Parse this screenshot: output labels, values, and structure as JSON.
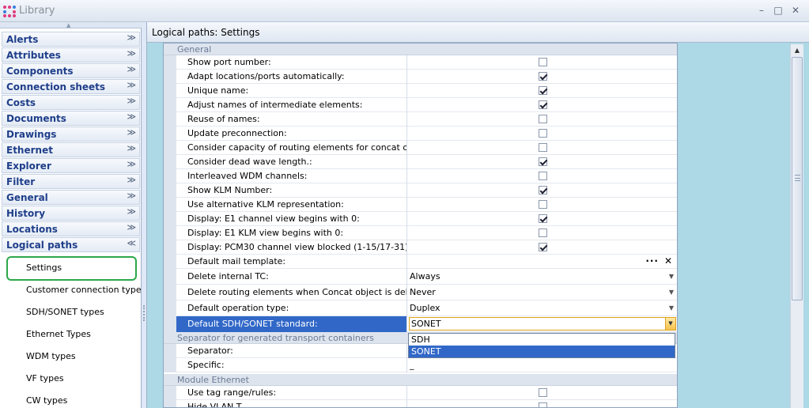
{
  "window": {
    "title": "Library",
    "minimize_glyph": "–",
    "maximize_glyph": "□",
    "close_glyph": "✕"
  },
  "nav": {
    "groups": [
      {
        "label": "Alerts",
        "chevron": "≫"
      },
      {
        "label": "Attributes",
        "chevron": "≫"
      },
      {
        "label": "Components",
        "chevron": "≫"
      },
      {
        "label": "Connection sheets",
        "chevron": "≫"
      },
      {
        "label": "Costs",
        "chevron": "≫"
      },
      {
        "label": "Documents",
        "chevron": "≫"
      },
      {
        "label": "Drawings",
        "chevron": "≫"
      },
      {
        "label": "Ethernet",
        "chevron": "≫"
      },
      {
        "label": "Explorer",
        "chevron": "≫"
      },
      {
        "label": "Filter",
        "chevron": "≫"
      },
      {
        "label": "General",
        "chevron": "≫"
      },
      {
        "label": "History",
        "chevron": "≫"
      },
      {
        "label": "Locations",
        "chevron": "≫"
      },
      {
        "label": "Logical paths",
        "chevron": "≪"
      }
    ],
    "items": [
      "Settings",
      "Customer connection types",
      "SDH/SONET types",
      "Ethernet Types",
      "WDM types",
      "VF types",
      "CW types"
    ],
    "selected_item": "Settings"
  },
  "panel": {
    "title": "Logical paths: Settings"
  },
  "grid": {
    "categories": [
      "General",
      "Separator for generated transport containers",
      "Module Ethernet"
    ],
    "general_rows": [
      {
        "name": "Show port number:",
        "checked": false
      },
      {
        "name": "Adapt locations/ports automatically:",
        "checked": true
      },
      {
        "name": "Unique name:",
        "checked": true
      },
      {
        "name": "Adjust names of intermediate elements:",
        "checked": true
      },
      {
        "name": "Reuse of names:",
        "checked": false
      },
      {
        "name": "Update preconnection:",
        "checked": false
      },
      {
        "name": "Consider capacity of routing elements for concat objects:",
        "checked": false
      },
      {
        "name": "Consider dead wave length.:",
        "checked": true
      },
      {
        "name": "Interleaved WDM channels:",
        "checked": false
      },
      {
        "name": "Show KLM Number:",
        "checked": true
      },
      {
        "name": "Use alternative KLM representation:",
        "checked": false
      },
      {
        "name": "Display: E1 channel view begins with 0:",
        "checked": true
      },
      {
        "name": "Display: E1 KLM view begins with 0:",
        "checked": false
      },
      {
        "name": "Display: PCM30 channel view blocked (1-15/17-31):",
        "checked": true
      }
    ],
    "mail_template": {
      "name": "Default mail template:",
      "value": ""
    },
    "delete_internal_tc": {
      "name": "Delete internal TC:",
      "value": "Always"
    },
    "delete_routing": {
      "name": "Delete routing elements when Concat object is deleted:",
      "value": "Never"
    },
    "default_operation": {
      "name": "Default operation type:",
      "value": "Duplex"
    },
    "default_standard": {
      "name": "Default SDH/SONET standard:",
      "value": "SONET"
    },
    "standard_options": [
      "SDH",
      "SONET"
    ],
    "separator_rows": [
      {
        "name": "Separator:",
        "value": ""
      },
      {
        "name": "Specific:",
        "value": "_"
      }
    ],
    "ethernet_rows": [
      {
        "name": "Use tag range/rules:",
        "checked": false
      },
      {
        "name": "Hide VLAN T...",
        "checked": false
      }
    ]
  }
}
